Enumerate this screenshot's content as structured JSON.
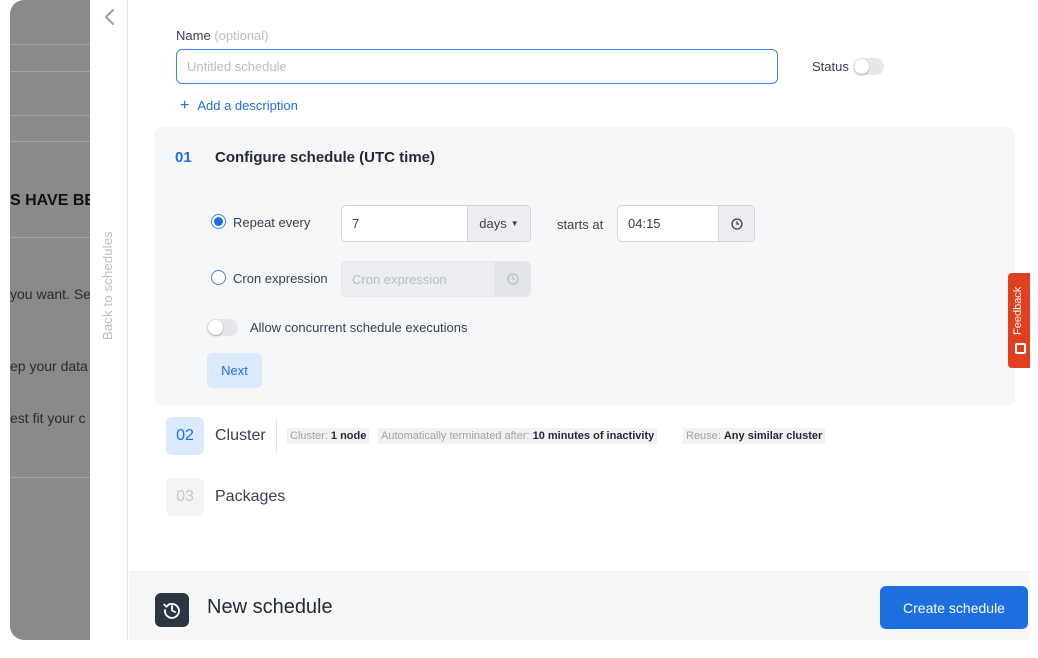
{
  "background_page": {
    "heading_fragment": "S HAVE BE",
    "text_1": "you want. Se",
    "text_2": "ep your data",
    "text_3": "est fit your c"
  },
  "rail": {
    "back_icon": "chevron-left-icon",
    "back_label": "Back to schedules"
  },
  "form": {
    "name_label": "Name",
    "name_optional": "(optional)",
    "name_placeholder": "Untitled schedule",
    "name_value": "",
    "status_label": "Status",
    "status_on": false,
    "add_description": "Add a description"
  },
  "step1": {
    "number": "01",
    "title": "Configure schedule (UTC time)",
    "repeat_label": "Repeat every",
    "repeat_selected": true,
    "repeat_value": "7",
    "repeat_unit": "days",
    "starts_at_label": "starts at",
    "start_time": "04:15",
    "cron_label": "Cron expression",
    "cron_selected": false,
    "cron_placeholder": "Cron expression",
    "concurrent_label": "Allow concurrent schedule executions",
    "concurrent_on": false,
    "next_label": "Next"
  },
  "step2": {
    "number": "02",
    "title": "Cluster",
    "tags": [
      {
        "key": "Cluster:",
        "value": "1 node"
      },
      {
        "key": "Automatically terminated after:",
        "value": "10 minutes of inactivity"
      },
      {
        "key": "Reuse:",
        "value": "Any similar cluster"
      }
    ]
  },
  "step3": {
    "number": "03",
    "title": "Packages"
  },
  "footer": {
    "icon": "schedule-history-icon",
    "title": "New schedule",
    "create_label": "Create schedule"
  },
  "feedback": {
    "label": "Feedback"
  },
  "colors": {
    "accent": "#1d6fe0",
    "feedback": "#e0401d",
    "panel": "#f6f7f9"
  }
}
